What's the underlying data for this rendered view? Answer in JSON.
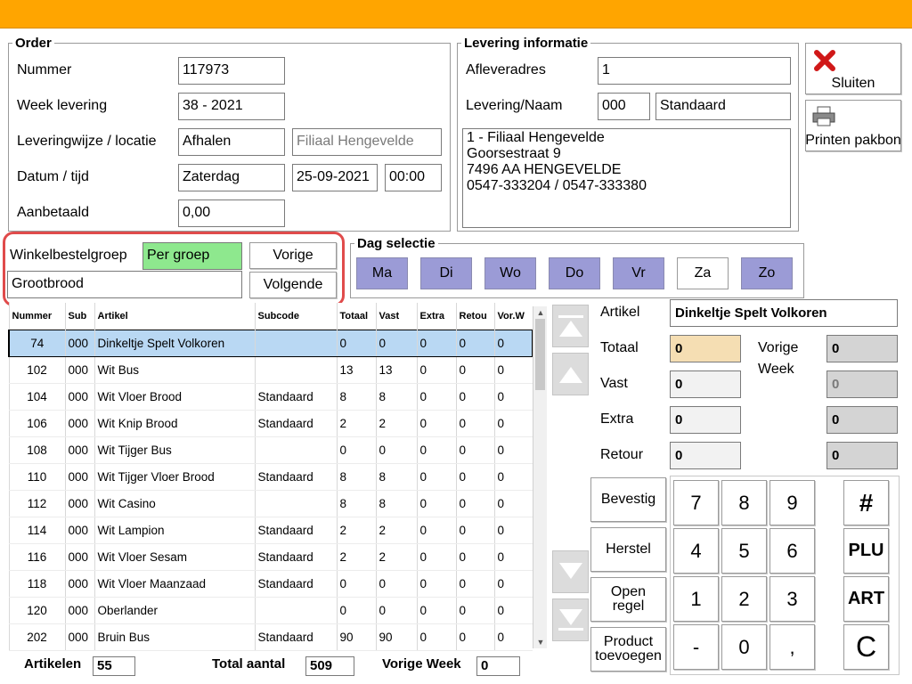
{
  "order": {
    "legend": "Order",
    "nummer_label": "Nummer",
    "nummer": "117973",
    "week_label": "Week levering",
    "week": "38 - 2021",
    "wijze_label": "Leveringwijze / locatie",
    "wijze": "Afhalen",
    "locatie": "Filiaal Hengevelde",
    "datum_label": "Datum / tijd",
    "dag": "Zaterdag",
    "datum": "25-09-2021",
    "tijd": "00:00",
    "aanbetaald_label": "Aanbetaald",
    "aanbetaald": "0,00"
  },
  "levering": {
    "legend": "Levering informatie",
    "adres_label": "Afleveradres",
    "adres": "1",
    "naam_label": "Levering/Naam",
    "code": "000",
    "naam": "Standaard",
    "address_lines": [
      "1 - Filiaal Hengevelde",
      "Goorsestraat 9",
      "7496 AA HENGEVELDE",
      "0547-333204 / 0547-333380"
    ]
  },
  "actions": {
    "close": "Sluiten",
    "print": "Printen pakbon"
  },
  "groep": {
    "label": "Winkelbestelgroep",
    "mode": "Per groep",
    "name": "Grootbrood",
    "prev": "Vorige",
    "next": "Volgende"
  },
  "days": {
    "legend": "Dag selectie",
    "items": [
      {
        "label": "Ma"
      },
      {
        "label": "Di"
      },
      {
        "label": "Wo"
      },
      {
        "label": "Do"
      },
      {
        "label": "Vr"
      },
      {
        "label": "Za"
      },
      {
        "label": "Zo"
      }
    ]
  },
  "table": {
    "headers": [
      "Nummer",
      "Sub",
      "Artikel",
      "Subcode",
      "Totaal",
      "Vast",
      "Extra",
      "Retou",
      "Vor.W"
    ],
    "rows": [
      [
        "74",
        "000",
        "Dinkeltje Spelt Volkoren",
        "",
        "0",
        "0",
        "0",
        "0",
        "0"
      ],
      [
        "102",
        "000",
        "Wit Bus",
        "",
        "13",
        "13",
        "0",
        "0",
        "0"
      ],
      [
        "104",
        "000",
        "Wit Vloer Brood",
        "Standaard",
        "8",
        "8",
        "0",
        "0",
        "0"
      ],
      [
        "106",
        "000",
        "Wit Knip Brood",
        "Standaard",
        "2",
        "2",
        "0",
        "0",
        "0"
      ],
      [
        "108",
        "000",
        "Wit Tijger Bus",
        "",
        "0",
        "0",
        "0",
        "0",
        "0"
      ],
      [
        "110",
        "000",
        "Wit Tijger Vloer Brood",
        "Standaard",
        "8",
        "8",
        "0",
        "0",
        "0"
      ],
      [
        "112",
        "000",
        "Wit Casino",
        "",
        "8",
        "8",
        "0",
        "0",
        "0"
      ],
      [
        "114",
        "000",
        "Wit Lampion",
        "Standaard",
        "2",
        "2",
        "0",
        "0",
        "0"
      ],
      [
        "116",
        "000",
        "Wit Vloer Sesam",
        "Standaard",
        "2",
        "2",
        "0",
        "0",
        "0"
      ],
      [
        "118",
        "000",
        "Wit Vloer Maanzaad",
        "Standaard",
        "0",
        "0",
        "0",
        "0",
        "0"
      ],
      [
        "120",
        "000",
        "Oberlander",
        "",
        "0",
        "0",
        "0",
        "0",
        "0"
      ],
      [
        "202",
        "000",
        "Bruin Bus",
        "Standaard",
        "90",
        "90",
        "0",
        "0",
        "0"
      ]
    ]
  },
  "detail": {
    "artikel_label": "Artikel",
    "artikel": "Dinkeltje Spelt Volkoren",
    "totaal_label": "Totaal",
    "totaal": "0",
    "vast_label": "Vast",
    "vast": "0",
    "extra_label": "Extra",
    "extra": "0",
    "retour_label": "Retour",
    "retour": "0",
    "vorige_label1": "Vorige",
    "vorige_label2": "Week",
    "vorige_totaal": "0",
    "vorige_vast": "0",
    "vorige_extra": "0",
    "vorige_retour": "0"
  },
  "cmd": {
    "bevestig": "Bevestig",
    "herstel": "Herstel",
    "open1": "Open",
    "open2": "regel",
    "prod1": "Product",
    "prod2": "toevoegen"
  },
  "keypad": {
    "keys": [
      "7",
      "8",
      "9",
      "4",
      "5",
      "6",
      "1",
      "2",
      "3",
      "-",
      "0",
      ","
    ],
    "specials": [
      "#",
      "PLU",
      "ART",
      "C"
    ]
  },
  "footer": {
    "artikelen_label": "Artikelen",
    "artikelen": "55",
    "total_label": "Total aantal",
    "total": "509",
    "vorige_label": "Vorige Week",
    "vorige": "0"
  },
  "colors": {
    "topbar": "#FFA500",
    "selected_day": "#9b9bd6",
    "per_groep": "#8ee88e",
    "totaal_field": "#f5deb3",
    "selected_row": "#b9d8f3",
    "highlight": "#e04b4b"
  }
}
